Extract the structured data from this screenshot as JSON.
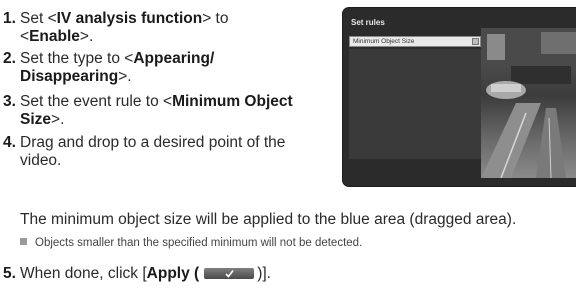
{
  "steps": [
    {
      "num": "1.",
      "pre": "Set <",
      "bold": "IV analysis function",
      "mid": "> to",
      "line2_pre": "<",
      "bold2": "Enable",
      "line2_post": ">."
    },
    {
      "num": "2.",
      "pre": "Set the type to <",
      "bold": "Appearing/",
      "bold2": "Disappearing",
      "line2_post": ">."
    },
    {
      "num": "3.",
      "pre": "Set the event rule to <",
      "bold": "Minimum Object",
      "bold2": "Size",
      "line2_post": ">."
    },
    {
      "num": "4.",
      "line1": "Drag and drop to a desired point of the",
      "line2": "video."
    },
    {
      "num": "5.",
      "pre": "When done, click [",
      "bold": "Apply (",
      "post": ")]."
    }
  ],
  "note": "The minimum object size will be applied to the blue area (dragged area).",
  "sub_note": "Objects smaller than the specified minimum will not be detected.",
  "panel": {
    "title": "Set rules",
    "select_value": "Minimum Object Size"
  }
}
